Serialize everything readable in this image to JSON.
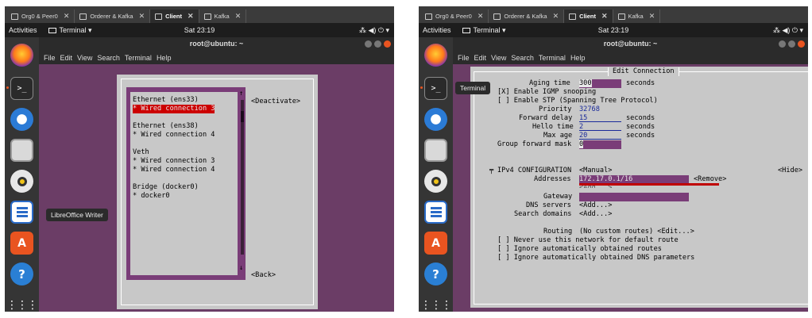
{
  "left": {
    "tabs": [
      {
        "label": "Org0 & Peer0",
        "active": false
      },
      {
        "label": "Orderer & Kafka",
        "active": false
      },
      {
        "label": "Client",
        "active": true
      },
      {
        "label": "Kafka",
        "active": false
      }
    ],
    "topbar": {
      "activities": "Activities",
      "terminal_menu": "Terminal ▾",
      "clock": "Sat 23:19",
      "tray": "⁂ ◀) ⏻ ▾"
    },
    "window_title": "root@ubuntu: ~",
    "menu": [
      "File",
      "Edit",
      "View",
      "Search",
      "Terminal",
      "Help"
    ],
    "tooltip": "LibreOffice Writer",
    "connections": [
      {
        "text": "Ethernet (ens33)",
        "selected": false
      },
      {
        "text": "* Wired connection 3",
        "selected": true
      },
      {
        "text": "",
        "selected": false
      },
      {
        "text": "Ethernet (ens38)",
        "selected": false
      },
      {
        "text": "* Wired connection 4",
        "selected": false
      },
      {
        "text": "",
        "selected": false
      },
      {
        "text": "Veth",
        "selected": false
      },
      {
        "text": "* Wired connection 3",
        "selected": false
      },
      {
        "text": "* Wired connection 4",
        "selected": false
      },
      {
        "text": "",
        "selected": false
      },
      {
        "text": "Bridge (docker0)",
        "selected": false
      },
      {
        "text": "* docker0",
        "selected": false
      }
    ],
    "deactivate": "<Deactivate>",
    "back": "<Back>",
    "scroll_up": "↑",
    "scroll_down": "↓"
  },
  "right": {
    "tabs": [
      {
        "label": "Org0 & Peer0",
        "active": false
      },
      {
        "label": "Orderer & Kafka",
        "active": false
      },
      {
        "label": "Client",
        "active": true
      },
      {
        "label": "Kafka",
        "active": false
      }
    ],
    "topbar": {
      "activities": "Activities",
      "terminal_menu": "Terminal ▾",
      "clock": "Sat 23:19",
      "tray": "⁂ ◀) ⏻ ▾"
    },
    "window_title": "root@ubuntu: ~",
    "menu": [
      "File",
      "Edit",
      "View",
      "Search",
      "Terminal",
      "Help"
    ],
    "tooltip": "Terminal",
    "dialog_title": "Edit Connection",
    "lines": {
      "aging_label": "Aging time",
      "aging_value": "300",
      "aging_unit": "seconds",
      "igmp": "[X] Enable IGMP snooping",
      "stp": "[ ] Enable STP (Spanning Tree Protocol)",
      "priority_label": "Priority",
      "priority_value": "32768",
      "forward_label": "Forward delay",
      "forward_value": "15",
      "forward_unit": "seconds",
      "hello_label": "Hello time",
      "hello_value": "2",
      "hello_unit": "seconds",
      "maxage_label": "Max age",
      "maxage_value": "20",
      "maxage_unit": "seconds",
      "group_label": "Group forward mask",
      "group_value": "0",
      "ipv4_label": "IPv4 CONFIGURATION",
      "ipv4_mode": "<Manual>",
      "hide": "<Hide>",
      "addresses_label": "Addresses",
      "addresses_value": "172.17.0.1/16",
      "remove": "<Remove>",
      "add_hidden": "<Add...>",
      "gateway_label": "Gateway",
      "dns_label": "DNS servers",
      "dns_add": "<Add...>",
      "search_label": "Search domains",
      "search_add": "<Add...>",
      "routing_label": "Routing",
      "routing_value": "(No custom routes) <Edit...>",
      "never_default": "[ ] Never use this network for default route",
      "ignore_routes": "[ ] Ignore automatically obtained routes",
      "ignore_dns": "[ ] Ignore automatically obtained DNS parameters"
    },
    "scroll_up": "↑",
    "scroll_down": "↓"
  },
  "colors": {
    "terminal_bg": "#6b3d66",
    "dialog_bg": "#c8c8c8",
    "field_bg": "#7a3d78",
    "selected_bg": "#cc0000",
    "annotation_red": "#c00000",
    "accent": "#e95420"
  }
}
